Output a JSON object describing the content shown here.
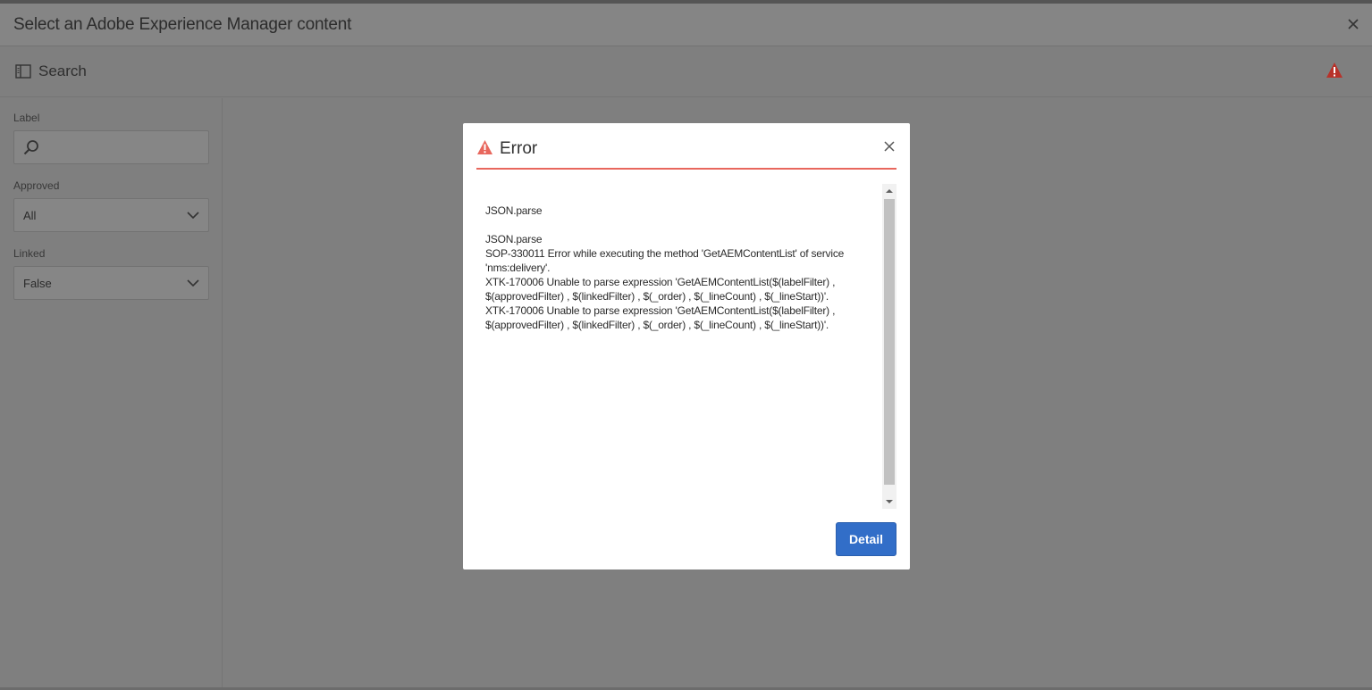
{
  "window": {
    "title": "Select an Adobe Experience Manager content",
    "close_icon": "close-icon"
  },
  "toolbar": {
    "toggle_icon": "sidebar-toggle-icon",
    "search_label": "Search",
    "alert_icon": "warning-icon",
    "alert_color": "#b8322a"
  },
  "sidebar": {
    "label_field": {
      "label": "Label",
      "value": "",
      "icon": "search-icon"
    },
    "approved_field": {
      "label": "Approved",
      "value": "All"
    },
    "linked_field": {
      "label": "Linked",
      "value": "False"
    }
  },
  "dialog": {
    "title": "Error",
    "accent_color": "#e8675d",
    "messages": [
      "JSON.parse",
      "",
      "JSON.parse",
      "SOP-330011 Error while executing the method 'GetAEMContentList' of service",
      "'nms:delivery'.",
      "XTK-170006 Unable to parse expression 'GetAEMContentList($(labelFilter) ,",
      "$(approvedFilter) , $(linkedFilter) , $(_order) , $(_lineCount) , $(_lineStart))'.",
      "XTK-170006 Unable to parse expression 'GetAEMContentList($(labelFilter) ,",
      "$(approvedFilter) , $(linkedFilter) , $(_order) , $(_lineCount) , $(_lineStart))'."
    ],
    "detail_button": "Detail",
    "button_color": "#326ec8"
  }
}
